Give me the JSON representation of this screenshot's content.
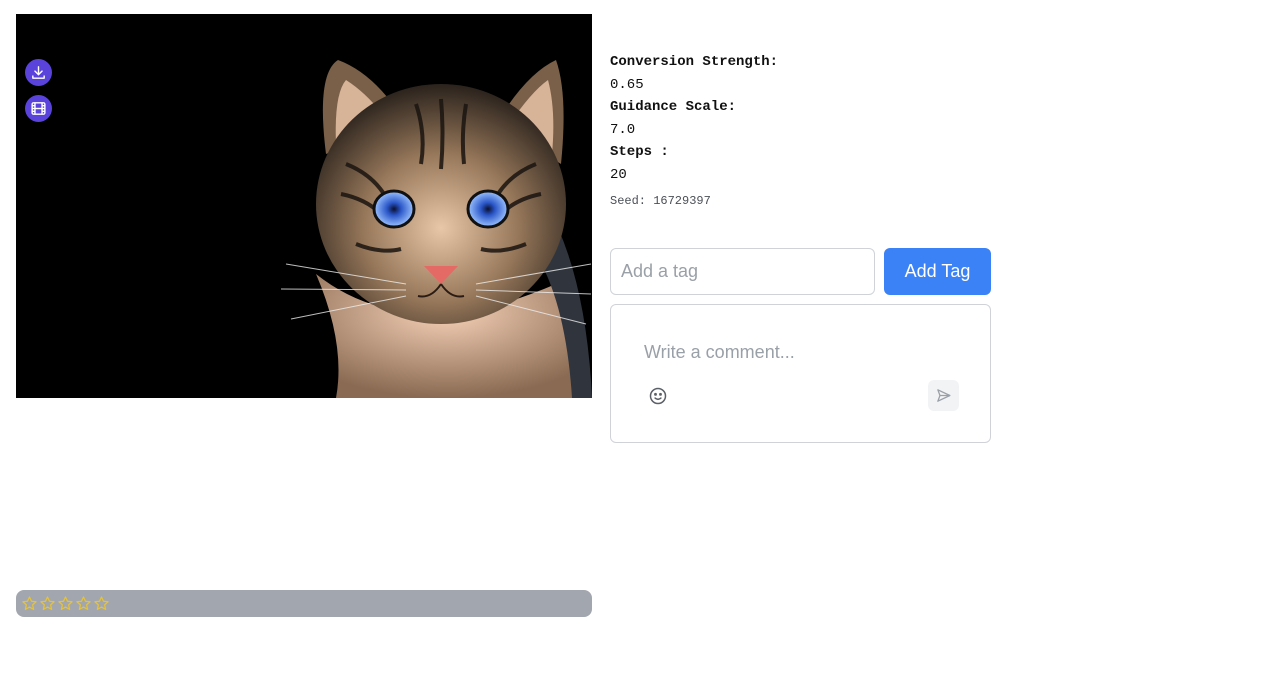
{
  "image": {
    "alt": "tabby cat portrait",
    "download_icon": "download-icon",
    "video_icon": "film-icon"
  },
  "rating": {
    "value": 0,
    "max": 5,
    "star_color": "#e5c23a"
  },
  "params": {
    "conversion_strength_label": "Conversion Strength:",
    "conversion_strength_value": "0.65",
    "guidance_scale_label": "Guidance Scale:",
    "guidance_scale_value": "7.0",
    "steps_label": "Steps :",
    "steps_value": "20",
    "seed": "Seed: 16729397"
  },
  "tag": {
    "placeholder": "Add a tag",
    "button_label": "Add Tag"
  },
  "comment": {
    "placeholder": "Write a comment..."
  },
  "colors": {
    "accent": "#3b82f6",
    "icon_button": "#5a43db"
  }
}
